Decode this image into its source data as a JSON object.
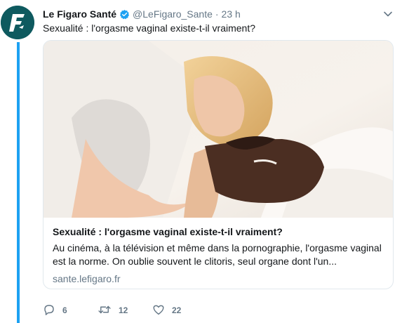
{
  "account": {
    "display_name": "Le Figaro Santé",
    "handle": "@LeFigaro_Sante",
    "separator": "·",
    "time": "23 h",
    "verified": true,
    "avatar_icon": "le-figaro-logo-icon",
    "avatar_color": "#0e5a5f"
  },
  "tweet": {
    "text": "Sexualité : l'orgasme vaginal existe-t-il vraiment?"
  },
  "card": {
    "image_subject": "couple-in-bed-photo",
    "title": "Sexualité : l'orgasme vaginal existe-t-il vraiment?",
    "description": "Au cinéma, à la télévision et même dans la pornographie, l'orgasme vaginal est la norme. On oublie souvent le clitoris, seul organe dont l'un...",
    "domain": "sante.lefigaro.fr"
  },
  "actions": {
    "replies": "6",
    "retweets": "12",
    "likes": "22"
  },
  "colors": {
    "thread_line": "#1da1f2",
    "verified": "#1da1f2",
    "muted_text": "#657786",
    "border": "#e1e8ed"
  }
}
